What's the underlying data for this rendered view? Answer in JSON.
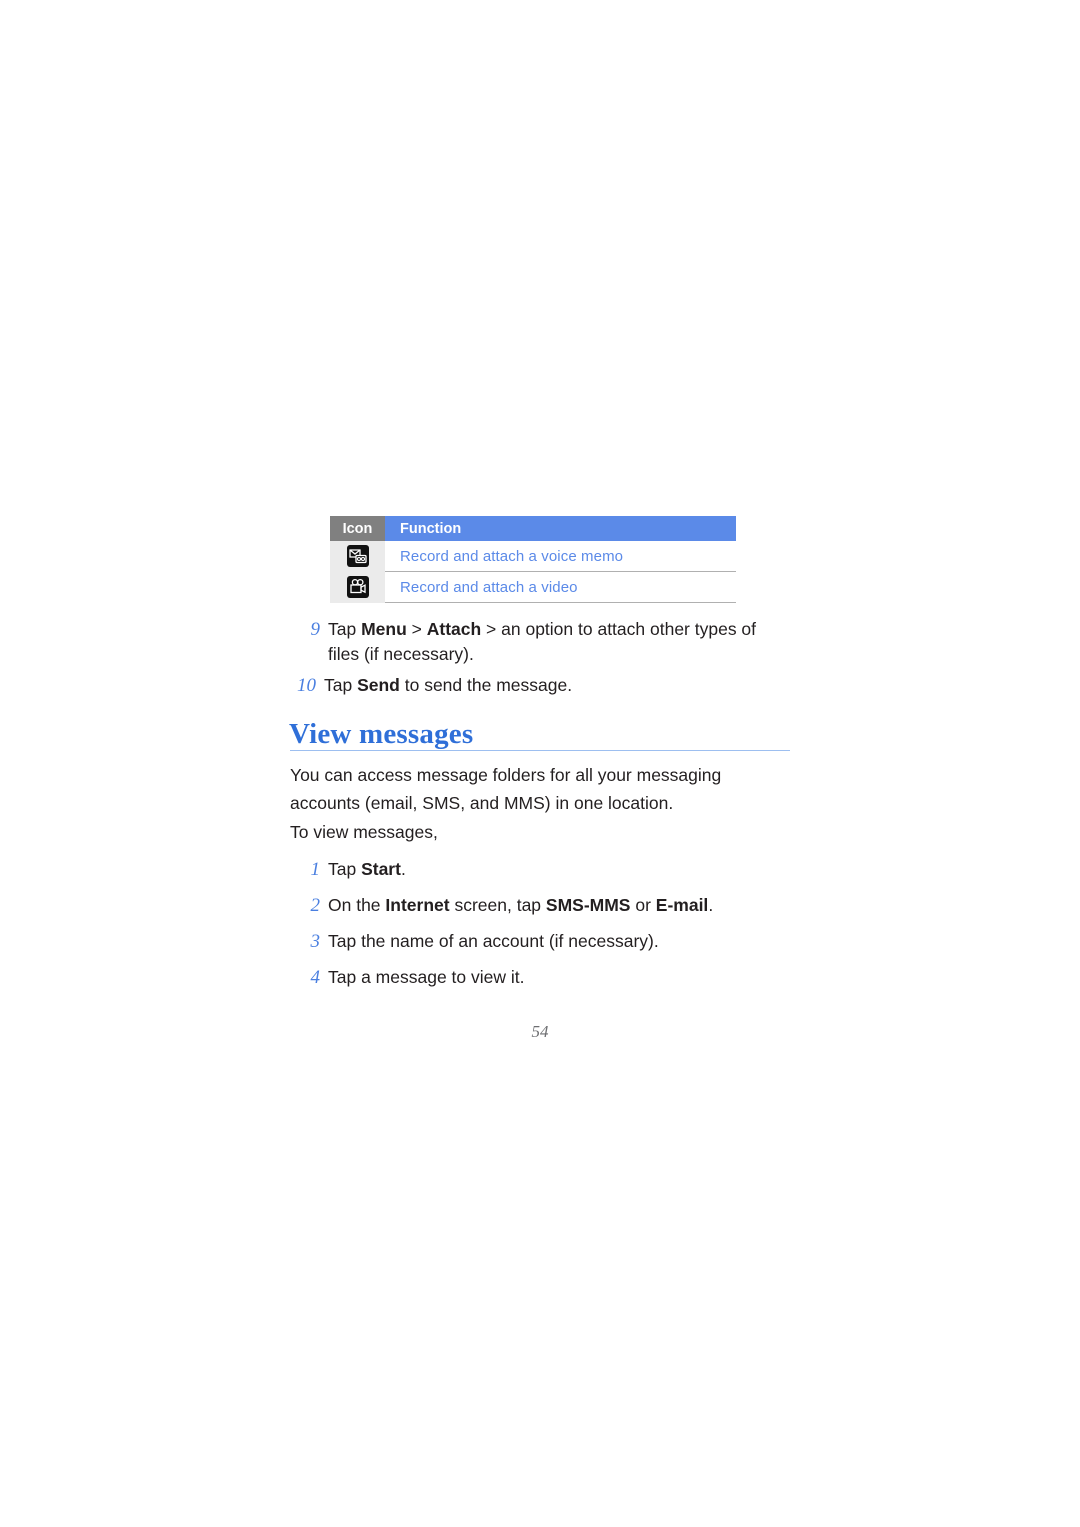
{
  "document": {
    "page_number": "54"
  },
  "icon_table": {
    "headers": {
      "icon": "Icon",
      "function": "Function"
    },
    "rows": [
      {
        "icon_name": "voice-memo-icon",
        "function": "Record and attach a voice memo"
      },
      {
        "icon_name": "video-camera-icon",
        "function": "Record and attach a video"
      }
    ],
    "colors": {
      "header_icon_bg": "#808080",
      "header_function_bg": "#5b8ae8",
      "row_icon_bg": "#ebebeb",
      "link_text": "#5b8ae8"
    }
  },
  "steps_upper": [
    {
      "number": "9",
      "parts": [
        {
          "text": "Tap ",
          "bold": false
        },
        {
          "text": "Menu",
          "bold": true
        },
        {
          "text": " > ",
          "bold": false
        },
        {
          "text": "Attach",
          "bold": true
        },
        {
          "text": " > an option to attach other types of files (if necessary).",
          "bold": false
        }
      ]
    },
    {
      "number": "10",
      "parts": [
        {
          "text": "Tap ",
          "bold": false
        },
        {
          "text": "Send",
          "bold": true
        },
        {
          "text": " to send the message.",
          "bold": false
        }
      ]
    }
  ],
  "section": {
    "heading": "View messages",
    "paragraph_1": "You can access message folders for all your messaging accounts (email, SMS, and MMS) in one location.",
    "paragraph_2": "To view messages,"
  },
  "steps_lower": [
    {
      "number": "1",
      "parts": [
        {
          "text": "Tap ",
          "bold": false
        },
        {
          "text": "Start",
          "bold": true
        },
        {
          "text": ".",
          "bold": false
        }
      ]
    },
    {
      "number": "2",
      "parts": [
        {
          "text": "On the ",
          "bold": false
        },
        {
          "text": "Internet",
          "bold": true
        },
        {
          "text": " screen, tap ",
          "bold": false
        },
        {
          "text": "SMS-MMS",
          "bold": true
        },
        {
          "text": " or ",
          "bold": false
        },
        {
          "text": "E-mail",
          "bold": true
        },
        {
          "text": ".",
          "bold": false
        }
      ]
    },
    {
      "number": "3",
      "parts": [
        {
          "text": "Tap the name of an account (if necessary).",
          "bold": false
        }
      ]
    },
    {
      "number": "4",
      "parts": [
        {
          "text": "Tap a message to view it.",
          "bold": false
        }
      ]
    }
  ]
}
